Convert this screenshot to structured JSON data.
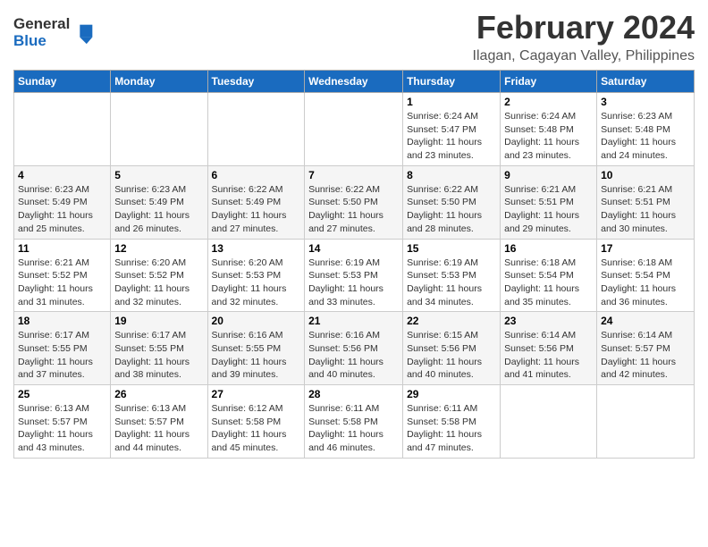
{
  "logo": {
    "general": "General",
    "blue": "Blue"
  },
  "title": "February 2024",
  "subtitle": "Ilagan, Cagayan Valley, Philippines",
  "days_of_week": [
    "Sunday",
    "Monday",
    "Tuesday",
    "Wednesday",
    "Thursday",
    "Friday",
    "Saturday"
  ],
  "weeks": [
    [
      {
        "day": "",
        "sunrise": "",
        "sunset": "",
        "daylight": ""
      },
      {
        "day": "",
        "sunrise": "",
        "sunset": "",
        "daylight": ""
      },
      {
        "day": "",
        "sunrise": "",
        "sunset": "",
        "daylight": ""
      },
      {
        "day": "",
        "sunrise": "",
        "sunset": "",
        "daylight": ""
      },
      {
        "day": "1",
        "sunrise": "Sunrise: 6:24 AM",
        "sunset": "Sunset: 5:47 PM",
        "daylight": "Daylight: 11 hours and 23 minutes."
      },
      {
        "day": "2",
        "sunrise": "Sunrise: 6:24 AM",
        "sunset": "Sunset: 5:48 PM",
        "daylight": "Daylight: 11 hours and 23 minutes."
      },
      {
        "day": "3",
        "sunrise": "Sunrise: 6:23 AM",
        "sunset": "Sunset: 5:48 PM",
        "daylight": "Daylight: 11 hours and 24 minutes."
      }
    ],
    [
      {
        "day": "4",
        "sunrise": "Sunrise: 6:23 AM",
        "sunset": "Sunset: 5:49 PM",
        "daylight": "Daylight: 11 hours and 25 minutes."
      },
      {
        "day": "5",
        "sunrise": "Sunrise: 6:23 AM",
        "sunset": "Sunset: 5:49 PM",
        "daylight": "Daylight: 11 hours and 26 minutes."
      },
      {
        "day": "6",
        "sunrise": "Sunrise: 6:22 AM",
        "sunset": "Sunset: 5:49 PM",
        "daylight": "Daylight: 11 hours and 27 minutes."
      },
      {
        "day": "7",
        "sunrise": "Sunrise: 6:22 AM",
        "sunset": "Sunset: 5:50 PM",
        "daylight": "Daylight: 11 hours and 27 minutes."
      },
      {
        "day": "8",
        "sunrise": "Sunrise: 6:22 AM",
        "sunset": "Sunset: 5:50 PM",
        "daylight": "Daylight: 11 hours and 28 minutes."
      },
      {
        "day": "9",
        "sunrise": "Sunrise: 6:21 AM",
        "sunset": "Sunset: 5:51 PM",
        "daylight": "Daylight: 11 hours and 29 minutes."
      },
      {
        "day": "10",
        "sunrise": "Sunrise: 6:21 AM",
        "sunset": "Sunset: 5:51 PM",
        "daylight": "Daylight: 11 hours and 30 minutes."
      }
    ],
    [
      {
        "day": "11",
        "sunrise": "Sunrise: 6:21 AM",
        "sunset": "Sunset: 5:52 PM",
        "daylight": "Daylight: 11 hours and 31 minutes."
      },
      {
        "day": "12",
        "sunrise": "Sunrise: 6:20 AM",
        "sunset": "Sunset: 5:52 PM",
        "daylight": "Daylight: 11 hours and 32 minutes."
      },
      {
        "day": "13",
        "sunrise": "Sunrise: 6:20 AM",
        "sunset": "Sunset: 5:53 PM",
        "daylight": "Daylight: 11 hours and 32 minutes."
      },
      {
        "day": "14",
        "sunrise": "Sunrise: 6:19 AM",
        "sunset": "Sunset: 5:53 PM",
        "daylight": "Daylight: 11 hours and 33 minutes."
      },
      {
        "day": "15",
        "sunrise": "Sunrise: 6:19 AM",
        "sunset": "Sunset: 5:53 PM",
        "daylight": "Daylight: 11 hours and 34 minutes."
      },
      {
        "day": "16",
        "sunrise": "Sunrise: 6:18 AM",
        "sunset": "Sunset: 5:54 PM",
        "daylight": "Daylight: 11 hours and 35 minutes."
      },
      {
        "day": "17",
        "sunrise": "Sunrise: 6:18 AM",
        "sunset": "Sunset: 5:54 PM",
        "daylight": "Daylight: 11 hours and 36 minutes."
      }
    ],
    [
      {
        "day": "18",
        "sunrise": "Sunrise: 6:17 AM",
        "sunset": "Sunset: 5:55 PM",
        "daylight": "Daylight: 11 hours and 37 minutes."
      },
      {
        "day": "19",
        "sunrise": "Sunrise: 6:17 AM",
        "sunset": "Sunset: 5:55 PM",
        "daylight": "Daylight: 11 hours and 38 minutes."
      },
      {
        "day": "20",
        "sunrise": "Sunrise: 6:16 AM",
        "sunset": "Sunset: 5:55 PM",
        "daylight": "Daylight: 11 hours and 39 minutes."
      },
      {
        "day": "21",
        "sunrise": "Sunrise: 6:16 AM",
        "sunset": "Sunset: 5:56 PM",
        "daylight": "Daylight: 11 hours and 40 minutes."
      },
      {
        "day": "22",
        "sunrise": "Sunrise: 6:15 AM",
        "sunset": "Sunset: 5:56 PM",
        "daylight": "Daylight: 11 hours and 40 minutes."
      },
      {
        "day": "23",
        "sunrise": "Sunrise: 6:14 AM",
        "sunset": "Sunset: 5:56 PM",
        "daylight": "Daylight: 11 hours and 41 minutes."
      },
      {
        "day": "24",
        "sunrise": "Sunrise: 6:14 AM",
        "sunset": "Sunset: 5:57 PM",
        "daylight": "Daylight: 11 hours and 42 minutes."
      }
    ],
    [
      {
        "day": "25",
        "sunrise": "Sunrise: 6:13 AM",
        "sunset": "Sunset: 5:57 PM",
        "daylight": "Daylight: 11 hours and 43 minutes."
      },
      {
        "day": "26",
        "sunrise": "Sunrise: 6:13 AM",
        "sunset": "Sunset: 5:57 PM",
        "daylight": "Daylight: 11 hours and 44 minutes."
      },
      {
        "day": "27",
        "sunrise": "Sunrise: 6:12 AM",
        "sunset": "Sunset: 5:58 PM",
        "daylight": "Daylight: 11 hours and 45 minutes."
      },
      {
        "day": "28",
        "sunrise": "Sunrise: 6:11 AM",
        "sunset": "Sunset: 5:58 PM",
        "daylight": "Daylight: 11 hours and 46 minutes."
      },
      {
        "day": "29",
        "sunrise": "Sunrise: 6:11 AM",
        "sunset": "Sunset: 5:58 PM",
        "daylight": "Daylight: 11 hours and 47 minutes."
      },
      {
        "day": "",
        "sunrise": "",
        "sunset": "",
        "daylight": ""
      },
      {
        "day": "",
        "sunrise": "",
        "sunset": "",
        "daylight": ""
      }
    ]
  ]
}
